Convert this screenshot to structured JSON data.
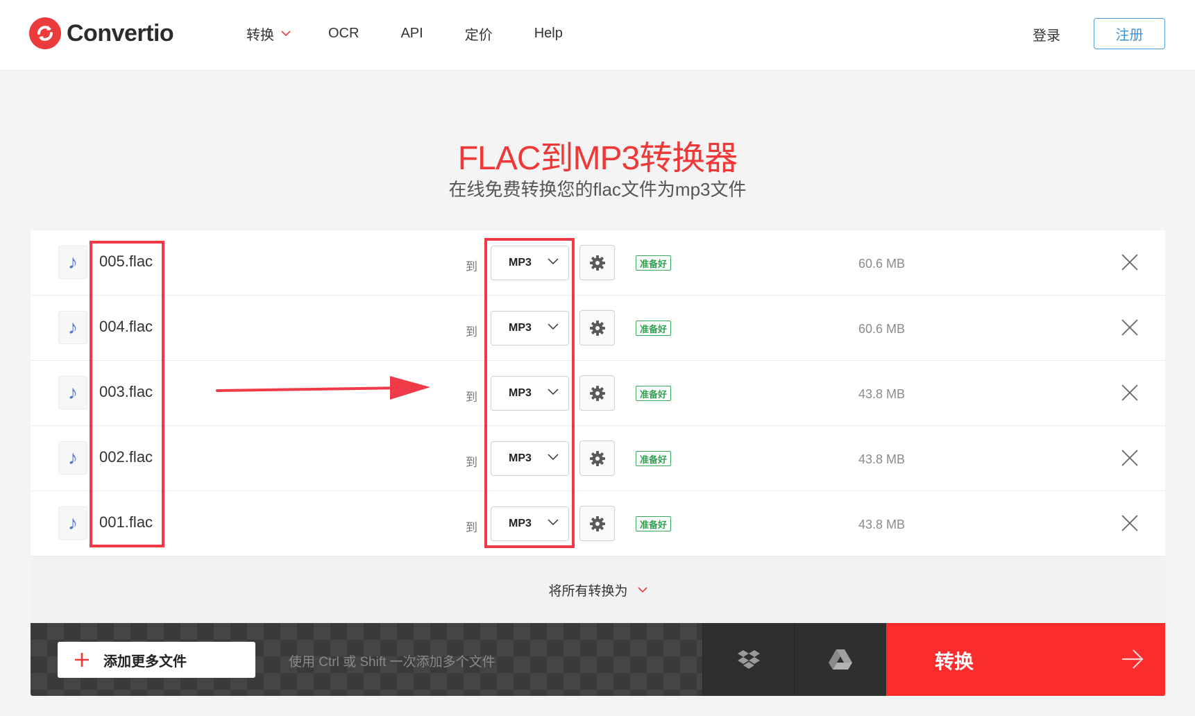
{
  "header": {
    "brand": "Convertio",
    "nav": [
      "转换",
      "OCR",
      "API",
      "定价",
      "Help"
    ],
    "login": "登录",
    "signup": "注册"
  },
  "hero": {
    "title": "FLAC到MP3转换器",
    "subtitle": "在线免费转换您的flac文件为mp3文件"
  },
  "files": [
    {
      "name": "005.flac",
      "to": "到",
      "format": "MP3",
      "status": "准备好",
      "size": "60.6 MB"
    },
    {
      "name": "004.flac",
      "to": "到",
      "format": "MP3",
      "status": "准备好",
      "size": "60.6 MB"
    },
    {
      "name": "003.flac",
      "to": "到",
      "format": "MP3",
      "status": "准备好",
      "size": "43.8 MB"
    },
    {
      "name": "002.flac",
      "to": "到",
      "format": "MP3",
      "status": "准备好",
      "size": "43.8 MB"
    },
    {
      "name": "001.flac",
      "to": "到",
      "format": "MP3",
      "status": "准备好",
      "size": "43.8 MB"
    }
  ],
  "convert_all": "将所有转换为",
  "bottom": {
    "add_label": "添加更多文件",
    "hint": "使用 Ctrl 或 Shift 一次添加多个文件",
    "convert_label": "转换"
  },
  "colors": {
    "brand_red": "#ef3838",
    "convert_red": "#fb2c2c",
    "ready_green": "#2fa14f",
    "signup_blue": "#3a95d6",
    "annotation_red": "#ee3b47"
  },
  "icons": {
    "logo": "convertio-logo-icon",
    "file": "music-note-icon",
    "settings": "gear-icon",
    "remove": "close-icon",
    "dropbox": "dropbox-icon",
    "gdrive": "google-drive-icon",
    "add": "plus-icon",
    "convert": "arrow-right-icon"
  }
}
